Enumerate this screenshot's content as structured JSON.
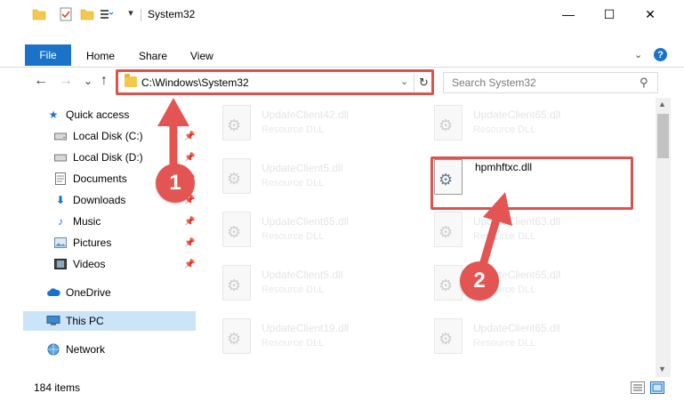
{
  "window": {
    "title": "System32",
    "minimize": "—",
    "maximize": "☐",
    "close": "✕"
  },
  "ribbon": {
    "tabs": [
      "File",
      "Home",
      "Share",
      "View"
    ],
    "help": "?"
  },
  "nav": {
    "back": "←",
    "forward": "→",
    "recent": "⌄",
    "up": "↑",
    "address": "C:\\Windows\\System32",
    "search_placeholder": "Search System32"
  },
  "sidebar": {
    "items": [
      {
        "label": "Quick access",
        "icon": "star-icon"
      },
      {
        "label": "Local Disk (C:)",
        "icon": "drive-icon",
        "pinned": true
      },
      {
        "label": "Local Disk (D:)",
        "icon": "drive-icon",
        "pinned": true
      },
      {
        "label": "Documents",
        "icon": "documents-icon",
        "pinned": true
      },
      {
        "label": "Downloads",
        "icon": "download-icon",
        "pinned": true
      },
      {
        "label": "Music",
        "icon": "music-icon",
        "pinned": true
      },
      {
        "label": "Pictures",
        "icon": "pictures-icon",
        "pinned": true
      },
      {
        "label": "Videos",
        "icon": "videos-icon",
        "pinned": true
      },
      {
        "label": "OneDrive",
        "icon": "cloud-icon"
      },
      {
        "label": "This PC",
        "icon": "computer-icon",
        "selected": true
      },
      {
        "label": "Network",
        "icon": "network-icon"
      }
    ]
  },
  "files": [
    {
      "name": "UpdateClient42.dll",
      "type": "Resource DLL"
    },
    {
      "name": "UpdateClient65.dll",
      "type": "Resource DLL"
    },
    {
      "name": "UpdateClient5.dll",
      "type": "Resource DLL"
    },
    {
      "name": "hpmhftxc.dll",
      "type": ""
    },
    {
      "name": "UpdateClient65.dll",
      "type": "Resource DLL"
    },
    {
      "name": "UpdateClient63.dll",
      "type": "Resource DLL"
    },
    {
      "name": "UpdateClient5.dll",
      "type": "Resource DLL"
    },
    {
      "name": "UpdateClient65.dll",
      "type": "Resource DLL"
    },
    {
      "name": "UpdateClient19.dll",
      "type": "Resource DLL"
    },
    {
      "name": "UpdateClient65.dll",
      "type": "Resource DLL"
    }
  ],
  "annotations": {
    "step1": "1",
    "step2": "2"
  },
  "status": {
    "count": "184 items"
  },
  "colors": {
    "accent": "#1a73c9",
    "annotation_red": "#e35552",
    "selection": "#cce4f7"
  }
}
